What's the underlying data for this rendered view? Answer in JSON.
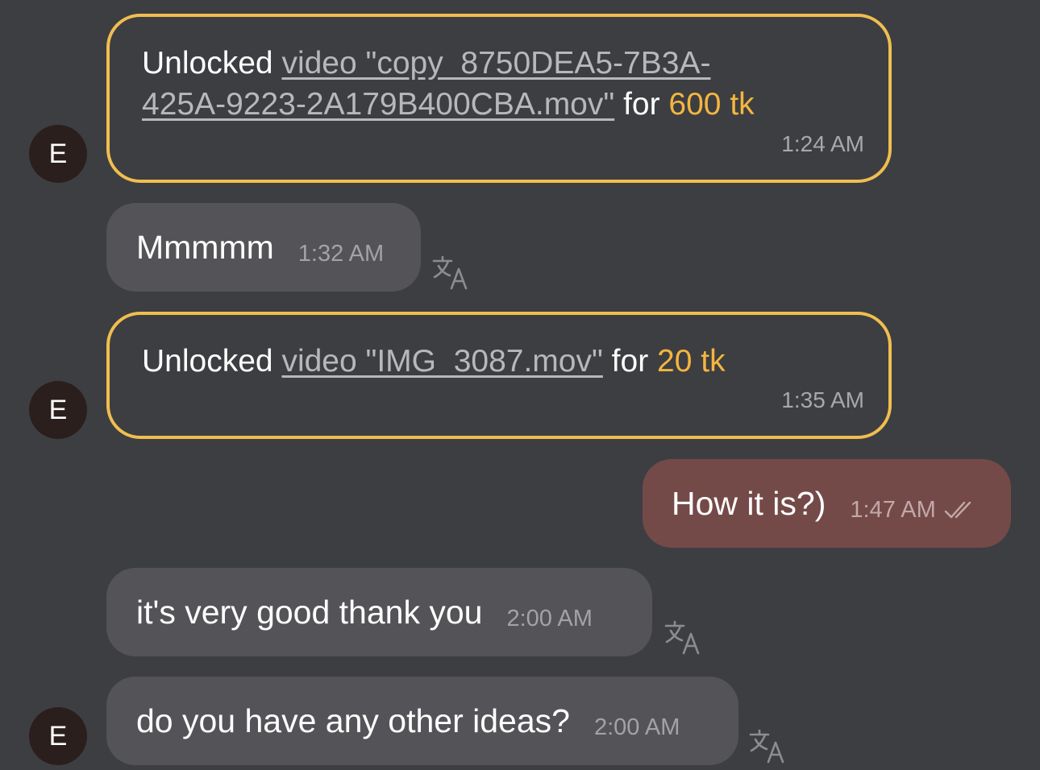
{
  "avatar_initial": "E",
  "messages": [
    {
      "type": "unlock",
      "prefix": "Unlocked",
      "link_line1": "video \"copy_8750DEA5-7B3A-",
      "link_line2": "425A-9223-2A179B400CBA.mov\"",
      "for_word": "for",
      "amount": "600 tk",
      "time": "1:24 AM"
    },
    {
      "type": "incoming",
      "text": "Mmmmm",
      "time": "1:32 AM",
      "translate_icon": "translate-icon"
    },
    {
      "type": "unlock",
      "prefix": "Unlocked",
      "link": "video \"IMG_3087.mov\"",
      "for_word": "for",
      "amount": "20 tk",
      "time": "1:35 AM"
    },
    {
      "type": "outgoing",
      "text": "How it is?)",
      "time": "1:47 AM",
      "status_icon": "double-check-icon"
    },
    {
      "type": "incoming",
      "text": "it's very good thank you",
      "time": "2:00 AM",
      "translate_icon": "translate-icon"
    },
    {
      "type": "incoming",
      "text": "do you have any other ideas?",
      "time": "2:00 AM",
      "translate_icon": "translate-icon"
    }
  ],
  "colors": {
    "background": "#3d3e41",
    "incoming_bubble": "#545458",
    "outgoing_bubble": "#744a49",
    "unlock_border": "#f0be4f",
    "amount": "#f4b63f"
  }
}
